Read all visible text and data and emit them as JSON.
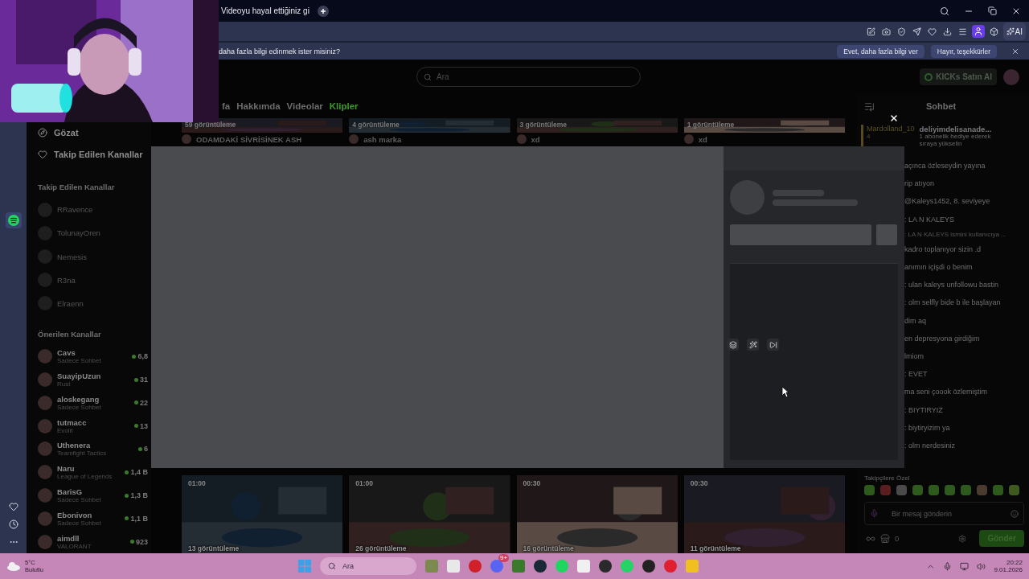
{
  "browser_tab": {
    "title": "Videoyu hayal ettiğiniz gi"
  },
  "toolbar": {
    "ai_label": "AI"
  },
  "infobar": {
    "message": "daha fazla bilgi edinmek ister misiniz?",
    "buttons": [
      "Evet, daha fazla bilgi ver",
      "Hayır, teşekkürler"
    ]
  },
  "header": {
    "search_placeholder": "Ara",
    "kicks_button": "KICKs Satın Al"
  },
  "channel_tabs": [
    {
      "label": "fa",
      "selected": false
    },
    {
      "label": "Hakkımda",
      "selected": false
    },
    {
      "label": "Videolar",
      "selected": false
    },
    {
      "label": "Klipler",
      "selected": true
    }
  ],
  "sidebar": {
    "nav": [
      "Gözat",
      "Takip Edilen Kanallar"
    ],
    "followed_title": "Takip Edilen Kanallar",
    "followed": [
      {
        "name": "RRavence"
      },
      {
        "name": "TolunayOren"
      },
      {
        "name": "Nemesis"
      },
      {
        "name": "R3na"
      },
      {
        "name": "Elraenn"
      }
    ],
    "recommended_title": "Önerilen Kanallar",
    "recommended": [
      {
        "name": "Cavs",
        "category": "Sadece Sohbet",
        "viewers": "6,8"
      },
      {
        "name": "SuayipUzun",
        "category": "Rust",
        "viewers": "31"
      },
      {
        "name": "aloskegang",
        "category": "Sadece Sohbet",
        "viewers": "22"
      },
      {
        "name": "tutmacc",
        "category": "Evolit",
        "viewers": "13"
      },
      {
        "name": "Uthenera",
        "category": "Teamfight Tactics",
        "viewers": "6"
      },
      {
        "name": "Naru",
        "category": "League of Legends",
        "viewers": "1,4 B"
      },
      {
        "name": "BarisG",
        "category": "Sadece Sohbet",
        "viewers": "1,3 B"
      },
      {
        "name": "Ebonivon",
        "category": "Sadece Sohbet",
        "viewers": "1,1 B"
      },
      {
        "name": "aimdll",
        "category": "VALORANT",
        "viewers": "923"
      }
    ]
  },
  "clips_top": [
    {
      "views": "59 görüntüleme",
      "title": "ODAMDAKİ SİVRİSİNEK ASH"
    },
    {
      "views": "4 görüntüleme",
      "title": "ash marka"
    },
    {
      "views": "3 görüntüleme",
      "title": "xd"
    },
    {
      "views": "1 görüntüleme",
      "title": "xd"
    }
  ],
  "clips_bottom": [
    {
      "duration": "01:00",
      "views": "13 görüntüleme"
    },
    {
      "duration": "01:00",
      "views": "26 görüntüleme"
    },
    {
      "duration": "00:30",
      "views": "16 görüntüleme"
    },
    {
      "duration": "00:30",
      "views": "11 görüntüleme"
    }
  ],
  "chat": {
    "title": "Sohbet",
    "pinned": {
      "user": "Mardolland_10",
      "count": "4"
    },
    "gift": {
      "user": "deliyimdelisanade...",
      "text": "1 abonelik hediye ederek sıraya yükselin"
    },
    "messages": [
      {
        "kind": "message",
        "text": "açınca özleseydin yayına"
      },
      {
        "kind": "message",
        "text": "rip atıyon"
      },
      {
        "kind": "message",
        "text": "@Kaleys1452, 8. seviyeye"
      },
      {
        "kind": "message",
        "text": ": LA N KALEYS"
      },
      {
        "kind": "reply",
        "text": ": LA N KALEYS ismini kullanıcıya ..."
      },
      {
        "kind": "message",
        "text": "kadro toplanıyor sizin .d"
      },
      {
        "kind": "message",
        "text": "anımın içişdi o benim"
      },
      {
        "kind": "message",
        "text": ": ulan kaleys unfollowu bastin"
      },
      {
        "kind": "message",
        "text": ": olm selfly bide b ile başlayan"
      },
      {
        "kind": "message",
        "text": "dim aq"
      },
      {
        "kind": "message",
        "text": "en depresyona girdiğim"
      },
      {
        "kind": "message",
        "text": "lmiom"
      },
      {
        "kind": "message",
        "text": ": EVET"
      },
      {
        "kind": "message",
        "text": "ma seni çoook özlemiştim"
      },
      {
        "kind": "message",
        "text": ": BIYTIRYIZ"
      },
      {
        "kind": "message",
        "text": ": biytiryizim ya"
      },
      {
        "kind": "message",
        "text": ": olm nerdesiniz"
      }
    ],
    "emote_label": "Takipçilere Özel",
    "input_placeholder": "Bir mesaj gönderin",
    "kicks_count": "0",
    "send_button": "Gönder"
  },
  "taskbar": {
    "weather_temp": "5°C",
    "weather_text": "Bulutlu",
    "search_placeholder": "Ara",
    "discord_badge": "9+",
    "time": "20:22",
    "date": "9.01.2026"
  }
}
